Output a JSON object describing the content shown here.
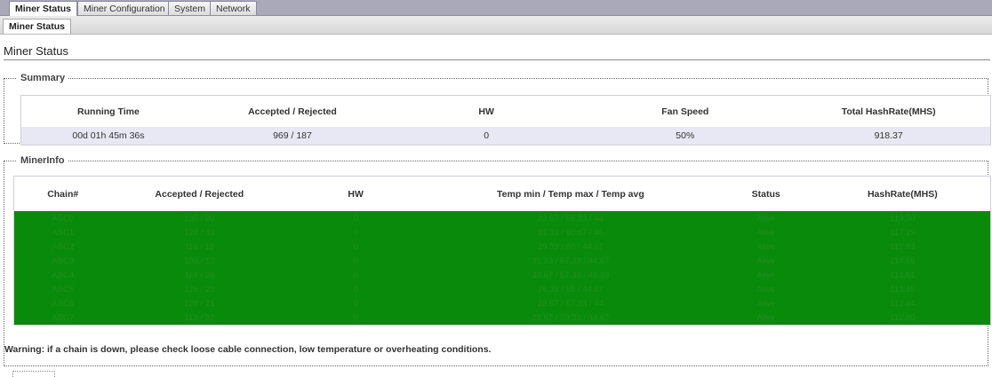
{
  "tabs": [
    {
      "label": "Miner Status",
      "active": true
    },
    {
      "label": "Miner Configuration",
      "active": false
    },
    {
      "label": "System",
      "active": false
    },
    {
      "label": "Network",
      "active": false
    }
  ],
  "subtab": {
    "label": "Miner Status"
  },
  "page_title": "Miner Status",
  "summary": {
    "legend": "Summary",
    "headers": {
      "running_time": "Running Time",
      "accepted_rejected": "Accepted / Rejected",
      "hw": "HW",
      "fan_speed": "Fan Speed",
      "total_hashrate": "Total HashRate(MHS)"
    },
    "values": {
      "running_time": "00d 01h 45m 36s",
      "accepted_rejected": "969 / 187",
      "hw": "0",
      "fan_speed": "50%",
      "total_hashrate": "918.37"
    }
  },
  "minerinfo": {
    "legend": "MinerInfo",
    "headers": {
      "chain": "Chain#",
      "accepted_rejected": "Accepted / Rejected",
      "hw": "HW",
      "temp": "Temp min / Temp max / Temp avg",
      "status": "Status",
      "hashrate": "HashRate(MHS)"
    },
    "rows": [
      {
        "chain": "ASC0",
        "accepted_rejected": "135 / 20",
        "hw": "0",
        "temp": "22.67 / 55.33 / 44",
        "status": "Alive",
        "hashrate": "119.30"
      },
      {
        "chain": "ASC1",
        "accepted_rejected": "128 / 33",
        "hw": "0",
        "temp": "33.33 / 60.67 / 46",
        "status": "Alive",
        "hashrate": "117.29"
      },
      {
        "chain": "ASC2",
        "accepted_rejected": "116 / 19",
        "hw": "0",
        "temp": "29.33 / 60 / 44.67",
        "status": "Alive",
        "hashrate": "112.83"
      },
      {
        "chain": "ASC3",
        "accepted_rejected": "109 / 13",
        "hw": "0",
        "temp": "31.33 / 57.33 / 44.67",
        "status": "Alive",
        "hashrate": "114.65"
      },
      {
        "chain": "ASC4",
        "accepted_rejected": "114 / 36",
        "hw": "0",
        "temp": "30.67 / 57.33 / 45.33",
        "status": "Alive",
        "hashrate": "114.61"
      },
      {
        "chain": "ASC5",
        "accepted_rejected": "126 / 23",
        "hw": "0",
        "temp": "26.33 / 58 / 44.67",
        "status": "Alive",
        "hashrate": "113.45"
      },
      {
        "chain": "ASC6",
        "accepted_rejected": "128 / 21",
        "hw": "0",
        "temp": "28.67 / 57.33 / 44",
        "status": "Alive",
        "hashrate": "113.44"
      },
      {
        "chain": "ASC7",
        "accepted_rejected": "113 / 32",
        "hw": "0",
        "temp": "28.67 / 59.33 / 44.67",
        "status": "Alive",
        "hashrate": "112.80"
      }
    ],
    "warning": "Warning: if a chain is down, please check loose cable connection, low temperature or overheating conditions."
  },
  "colors": {
    "row_ok": "#0a8a0a",
    "row_text": "#1e8f1e",
    "summary_row": "#e8e8f4",
    "topbar": "#a9a9b9"
  }
}
